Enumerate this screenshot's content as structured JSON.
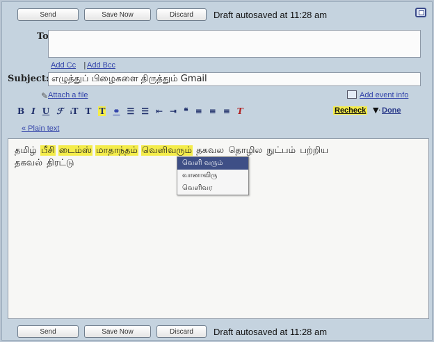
{
  "toolbar_top": {
    "send_label": "Send",
    "save_now_label": "Save Now",
    "discard_label": "Discard",
    "status": "Draft autosaved at 11:28 am"
  },
  "toolbar_bottom": {
    "send_label": "Send",
    "save_now_label": "Save Now",
    "discard_label": "Discard",
    "status": "Draft autosaved at 11:28 am"
  },
  "header": {
    "to_label": "To:",
    "to_value": "",
    "add_cc": "Add Cc",
    "cc_bcc_separator": "|",
    "add_bcc": "Add Bcc",
    "subject_label": "Subject:",
    "subject_value": "எழுத்துப் பிழைகளை திருத்தும் Gmail",
    "attach_label": "Attach a file",
    "add_event_label": "Add event info"
  },
  "format_bar": {
    "bold": "B",
    "italic": "I",
    "underline": "U",
    "font": "ℱ",
    "size": "ᵢT",
    "text_color": "T",
    "highlight": "T",
    "link": "⚭",
    "numbered_list": "☰",
    "bulleted_list": "☰",
    "outdent": "⇤",
    "indent": "⇥",
    "quote": "❝",
    "align_left": "≡",
    "align_center": "≡",
    "align_right": "≡",
    "remove_format": "T",
    "recheck_label": "Recheck",
    "recheck_arrow": "▼",
    "separator_dot": "·",
    "done_label": "Done",
    "plain_text_label": "« Plain text"
  },
  "body": {
    "words": [
      {
        "text": "தமிழ்",
        "misspelled": false
      },
      {
        "text": "பீசி",
        "misspelled": true
      },
      {
        "text": "டைம்ஸ்",
        "misspelled": true
      },
      {
        "text": "மாதாந்தம்",
        "misspelled": true
      },
      {
        "text": "வெளிவரும்",
        "misspelled": true
      },
      {
        "text": "தகவல",
        "misspelled": false
      },
      {
        "text": "தொழில",
        "misspelled": false
      },
      {
        "text": "நுட்பம்",
        "misspelled": false
      },
      {
        "text": "பற்றிய",
        "misspelled": false
      },
      {
        "text": "தகவல்",
        "misspelled": false
      },
      {
        "text": "திரட்டு",
        "misspelled": false
      }
    ]
  },
  "spell_menu": {
    "options": [
      "வெளி வரும்",
      "வானாவிரு",
      "வெளிவர"
    ],
    "active_index": 0
  },
  "colors": {
    "background": "#c5d3df",
    "misspelling_highlight": "#f4ec4a",
    "menu_selected": "#3e4f86",
    "link": "#3344aa"
  }
}
